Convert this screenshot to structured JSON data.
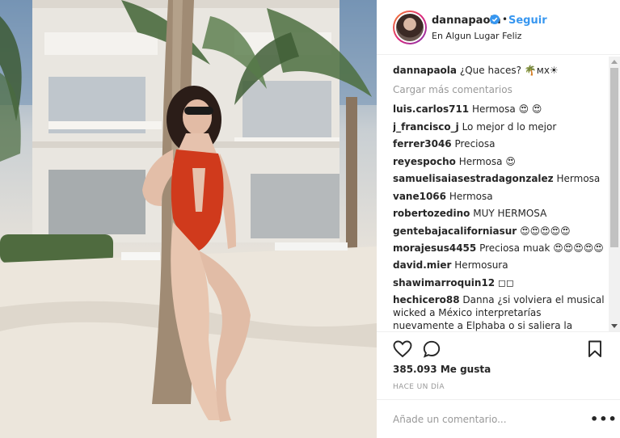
{
  "post": {
    "username": "dannapaola",
    "verified_icon": "verified-badge-icon",
    "separator": "•",
    "follow_label": "Seguir",
    "location": "En Algun Lugar Feliz",
    "photo_description_icon": "beach-photo"
  },
  "caption": {
    "user": "dannapaola",
    "text": "¿Que haces? 🌴ᴍx☀"
  },
  "load_more_label": "Cargar más comentarios",
  "comments": [
    {
      "user": "luis.carlos711",
      "text": "Hermosa 😍 😍"
    },
    {
      "user": "j_francisco_j",
      "text": "Lo mejor d lo mejor"
    },
    {
      "user": "ferrer3046",
      "text": "Preciosa"
    },
    {
      "user": "reyespocho",
      "text": "Hermosa 😍"
    },
    {
      "user": "samuelisaiasestradagonzalez",
      "text": "Hermosa"
    },
    {
      "user": "vane1066",
      "text": "Hermosa"
    },
    {
      "user": "robertozedino",
      "text": "MUY HERMOSA"
    },
    {
      "user": "gentebajacaliforniasur",
      "text": "😍😍😍😍😍"
    },
    {
      "user": "morajesus4455",
      "text": "Preciosa muak 😍😍😍😍😍"
    },
    {
      "user": "david.mier",
      "text": "Hermosura"
    },
    {
      "user": "shawimarroquin12",
      "text": "◻◻"
    },
    {
      "user": "hechicero88",
      "text": "Danna ¿si volviera el musical wicked a México interpretarías nuevamente a Elphaba o si saliera la película doblarías"
    }
  ],
  "actions": {
    "like_icon": "heart-icon",
    "comment_icon": "comment-bubble-icon",
    "save_icon": "bookmark-icon"
  },
  "likes": "385.093 Me gusta",
  "timestamp": "HACE UN DÍA",
  "add_comment": {
    "placeholder": "Añade un comentario...",
    "more_icon": "more-options-icon",
    "more_label": "•••"
  },
  "colors": {
    "link": "#3897f0",
    "muted": "#999999",
    "text": "#262626"
  }
}
